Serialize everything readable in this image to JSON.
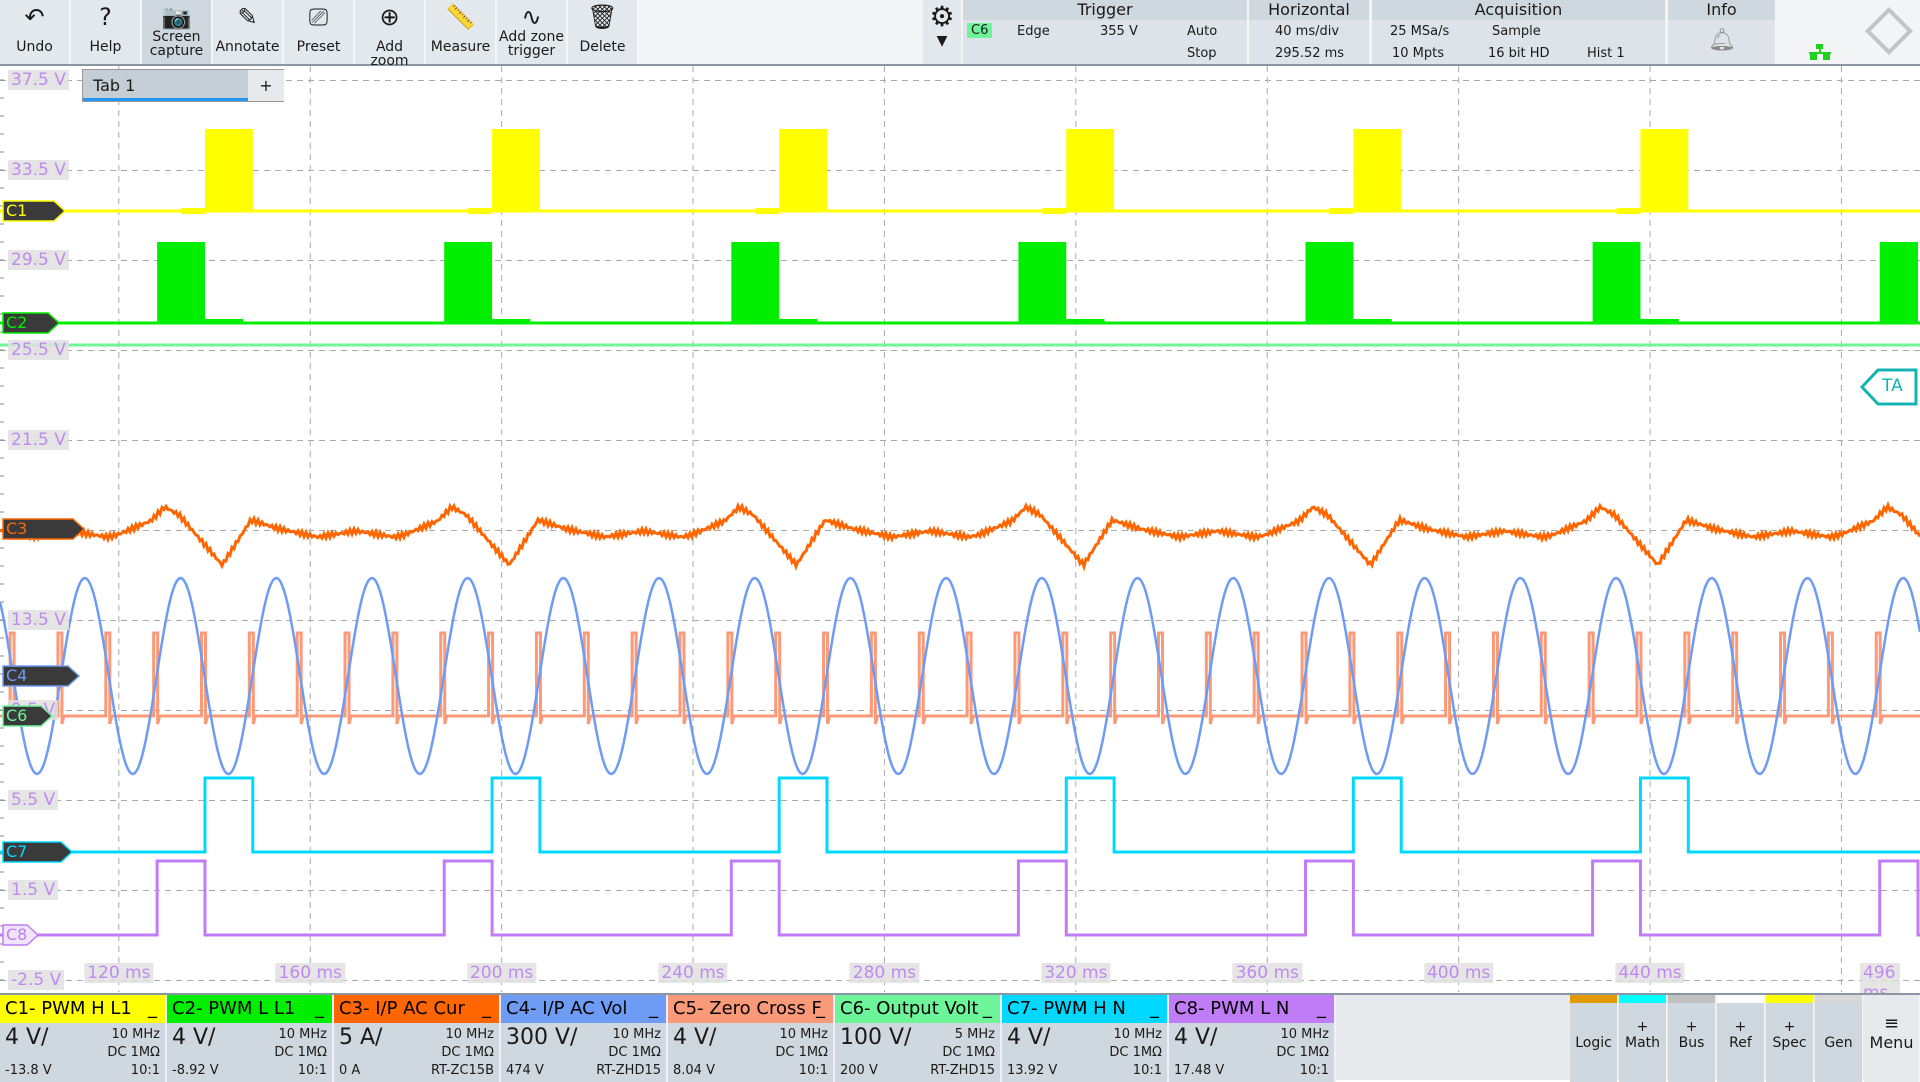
{
  "toolbar": {
    "buttons": [
      {
        "label": "Undo",
        "icon": "undo-icon",
        "glyph": "↶"
      },
      {
        "label": "Help",
        "icon": "help-icon",
        "glyph": "?"
      },
      {
        "label": "Screen\ncapture",
        "icon": "camera-icon",
        "glyph": "📷"
      },
      {
        "label": "Annotate",
        "icon": "pencil-icon",
        "glyph": "✎"
      },
      {
        "label": "Preset",
        "icon": "preset-icon",
        "glyph": "⎚"
      },
      {
        "label": "Add zoom",
        "icon": "zoom-in-icon",
        "glyph": "⊕"
      },
      {
        "label": "Measure",
        "icon": "ruler-icon",
        "glyph": "📏"
      },
      {
        "label": "Add zone\ntrigger",
        "icon": "zone-trigger-icon",
        "glyph": "∿"
      },
      {
        "label": "Delete",
        "icon": "trash-icon",
        "glyph": "🗑"
      }
    ]
  },
  "trigger": {
    "title": "Trigger",
    "source": "C6",
    "type": "Edge",
    "level": "355 V",
    "mode": "Auto",
    "state": "Stop",
    "source_color": "#6ef59a"
  },
  "horizontal": {
    "title": "Horizontal",
    "scale": "40 ms/div",
    "position": "295.52 ms"
  },
  "acquisition": {
    "title": "Acquisition",
    "rate": "25 MSa/s",
    "mode": "Sample",
    "points": "10 Mpts",
    "resolution": "16 bit HD",
    "hist": "Hist 1"
  },
  "info": {
    "title": "Info"
  },
  "tab": {
    "label": "Tab 1",
    "add": "+"
  },
  "ta_label": "TA",
  "y_labels": [
    "37.5 V",
    "33.5 V",
    "29.5 V",
    "25.5 V",
    "21.5 V",
    "17.5 V",
    "13.5 V",
    "9.5 V",
    "5.5 V",
    "1.5 V",
    "-2.5 V"
  ],
  "x_labels": [
    "120 ms",
    "160 ms",
    "200 ms",
    "240 ms",
    "280 ms",
    "320 ms",
    "360 ms",
    "400 ms",
    "440 ms",
    "496 ms"
  ],
  "channels": [
    {
      "id": "C1",
      "name": "C1- PWM H L1",
      "scale": "4 V/",
      "bw": "10 MHz",
      "coupling": "DC 1MΩ",
      "offset": "-13.8 V",
      "probe": "10:1",
      "color": "#ffff00",
      "text": "#000"
    },
    {
      "id": "C2",
      "name": "C2- PWM L L1",
      "scale": "4 V/",
      "bw": "10 MHz",
      "coupling": "DC 1MΩ",
      "offset": "-8.92 V",
      "probe": "10:1",
      "color": "#00ee00",
      "text": "#000"
    },
    {
      "id": "C3",
      "name": "C3- I/P AC Cur",
      "scale": "5 A/",
      "bw": "10 MHz",
      "coupling": "DC 1MΩ",
      "offset": "0 A",
      "probe": "RT-ZC15B",
      "color": "#ff6600",
      "text": "#000"
    },
    {
      "id": "C4",
      "name": "C4- I/P AC Vol",
      "scale": "300 V/",
      "bw": "10 MHz",
      "coupling": "DC 1MΩ",
      "offset": "474 V",
      "probe": "RT-ZHD15",
      "color": "#6e9cf5",
      "text": "#000"
    },
    {
      "id": "C5",
      "name": "C5- Zero Cross F",
      "scale": "4 V/",
      "bw": "10 MHz",
      "coupling": "DC 1MΩ",
      "offset": "8.04 V",
      "probe": "10:1",
      "color": "#fb9a78",
      "text": "#000"
    },
    {
      "id": "C6",
      "name": "C6- Output Volt",
      "scale": "100 V/",
      "bw": "5 MHz",
      "coupling": "DC 1MΩ",
      "offset": "200 V",
      "probe": "RT-ZHD15",
      "color": "#6ef59a",
      "text": "#000"
    },
    {
      "id": "C7",
      "name": "C7- PWM H N",
      "scale": "4 V/",
      "bw": "10 MHz",
      "coupling": "DC 1MΩ",
      "offset": "13.92 V",
      "probe": "10:1",
      "color": "#00d8ff",
      "text": "#000"
    },
    {
      "id": "C8",
      "name": "C8- PWM L N",
      "scale": "4 V/",
      "bw": "10 MHz",
      "coupling": "DC 1MΩ",
      "offset": "17.48 V",
      "probe": "10:1",
      "color": "#c07cf7",
      "text": "#000"
    }
  ],
  "minimize": "_",
  "right_buttons": [
    {
      "label": "Logic",
      "plus": "",
      "color": "#e39a00"
    },
    {
      "label": "Math",
      "plus": "+",
      "color": "#00ffff"
    },
    {
      "label": "Bus",
      "plus": "+",
      "color": "#c0c0c0"
    },
    {
      "label": "Ref",
      "plus": "+",
      "color": "#ffffff"
    },
    {
      "label": "Spec",
      "plus": "+",
      "color": "#ffff00"
    },
    {
      "label": "Gen",
      "plus": "",
      "color": "#d8d8d8"
    }
  ],
  "menu": "Menu",
  "waveforms": {
    "time_range_ms": [
      96,
      496
    ],
    "pwm_period_ms": 60,
    "pwm_width_ms": 10,
    "high_side_first_edge_ms": 138,
    "low_side_first_edge_ms": 128,
    "ac_period_ms": 20,
    "ac_first_peak_ms": 112.9
  }
}
